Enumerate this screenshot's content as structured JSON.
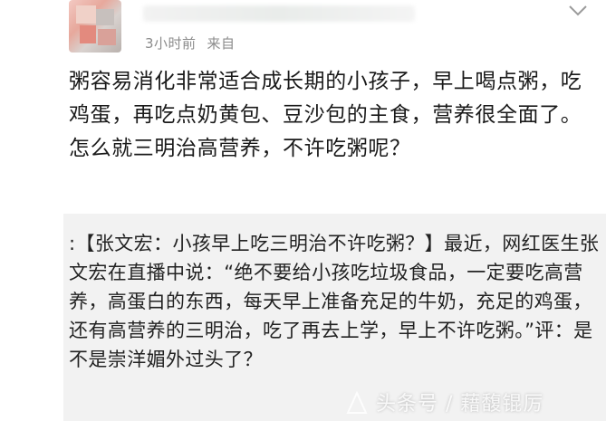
{
  "post": {
    "meta": {
      "time": "3小时前",
      "source": "来自"
    },
    "body": "粥容易消化非常适合成长期的小孩子，早上喝点粥，吃鸡蛋，再吃点奶黄包、豆沙包的主食，营养很全面了。怎么就三明治高营养，不许吃粥呢？"
  },
  "quoted": {
    "text": ":【张文宏：小孩早上吃三明治不许吃粥？】最近，网红医生张文宏在直播中说：“绝不要给小孩吃垃圾食品，一定要吃高营养，高蛋白的东西，每天早上准备充足的牛奶，充足的鸡蛋，还有高营养的三明治，吃了再去上学，早上不许吃粥。”评：是不是崇洋媚外过头了？"
  },
  "watermark": {
    "text": "头条号 / 藉馥锟厉"
  },
  "icons": {
    "menu": "chevron-down-icon",
    "avatar": "user-avatar"
  },
  "colors": {
    "meta": "#8b8b8b",
    "quote_bg": "#f2f2f2",
    "text": "#1a1a1a"
  }
}
